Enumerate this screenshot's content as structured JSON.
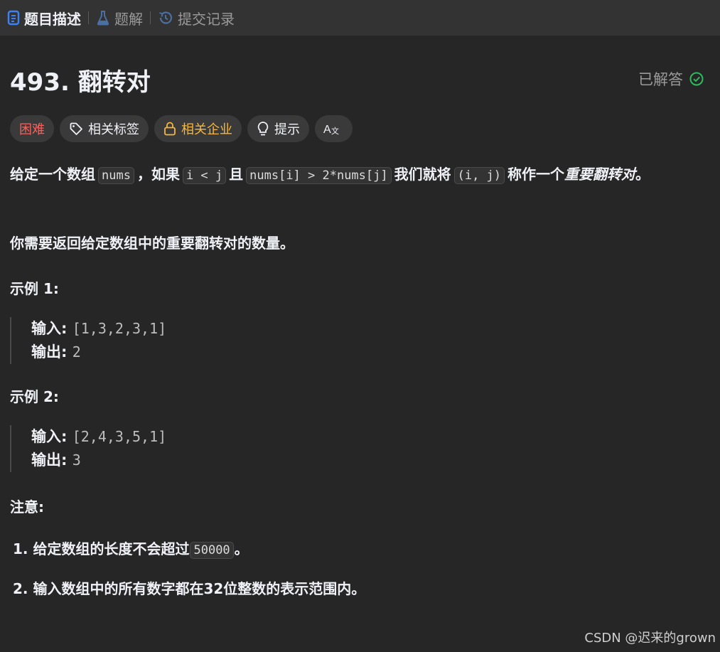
{
  "tabs": [
    {
      "label": "题目描述",
      "icon": "document-icon",
      "active": true,
      "color": "#3b82f6"
    },
    {
      "label": "题解",
      "icon": "flask-icon",
      "active": false,
      "color": "#4a6fa5"
    },
    {
      "label": "提交记录",
      "icon": "history-icon",
      "active": false,
      "color": "#4a6fa5"
    }
  ],
  "problem": {
    "title": "493. 翻转对",
    "status": "已解答",
    "status_color": "#2cbb5d"
  },
  "tags": {
    "difficulty": "困难",
    "topics": "相关标签",
    "companies": "相关企业",
    "hint": "提示",
    "translate": "Aあ"
  },
  "description": {
    "p1_a": "给定一个数组",
    "p1_code1": "nums",
    "p1_b": "，如果",
    "p1_code2": "i < j",
    "p1_c": "且",
    "p1_code3": "nums[i] > 2*nums[j]",
    "p1_d": "我们就将",
    "p1_code4": "(i, j)",
    "p1_e": "称作一个",
    "p1_em": "重要翻转对",
    "p1_f": "。",
    "p2": "你需要返回给定数组中的重要翻转对的数量。"
  },
  "examples": [
    {
      "heading": "示例 1:",
      "input_label": "输入",
      "input": "[1,3,2,3,1]",
      "output_label": "输出",
      "output": "2"
    },
    {
      "heading": "示例 2:",
      "input_label": "输入",
      "input": "[2,4,3,5,1]",
      "output_label": "输出",
      "output": "3"
    }
  ],
  "notes": {
    "heading": "注意:",
    "item1_prefix": "1. 给定数组的长度不会超过",
    "item1_code": "50000",
    "item1_suffix": "。",
    "item2": "2. 输入数组中的所有数字都在32位整数的表示范围内。"
  },
  "watermark": "CSDN @迟来的grown",
  "colors": {
    "background": "#262626",
    "topbar": "#333333",
    "hard": "#f8615c",
    "company": "#f6b73c"
  }
}
